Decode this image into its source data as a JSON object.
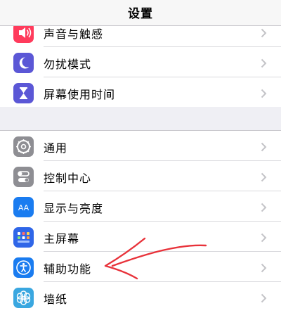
{
  "navbar": {
    "title": "设置"
  },
  "group1": {
    "items": [
      {
        "label": "声音与触感",
        "icon": "speaker-icon",
        "color": "#ff3b5c"
      },
      {
        "label": "勿扰模式",
        "icon": "moon-icon",
        "color": "#5b57d6"
      },
      {
        "label": "屏幕使用时间",
        "icon": "hourglass-icon",
        "color": "#5b57d6"
      }
    ]
  },
  "group2": {
    "items": [
      {
        "label": "通用",
        "icon": "gear-icon",
        "color": "#8e8e93"
      },
      {
        "label": "控制中心",
        "icon": "toggles-icon",
        "color": "#8e8e93"
      },
      {
        "label": "显示与亮度",
        "icon": "aa-icon",
        "color": "#1a7cf0",
        "icon_text": "AA"
      },
      {
        "label": "主屏幕",
        "icon": "home-grid-icon",
        "color": "#2f66e8"
      },
      {
        "label": "辅助功能",
        "icon": "accessibility-icon",
        "color": "#1a7cf0"
      },
      {
        "label": "墙纸",
        "icon": "flower-icon",
        "color": "#3aa7e0"
      }
    ]
  },
  "annotation": {
    "color": "#e8323a"
  }
}
